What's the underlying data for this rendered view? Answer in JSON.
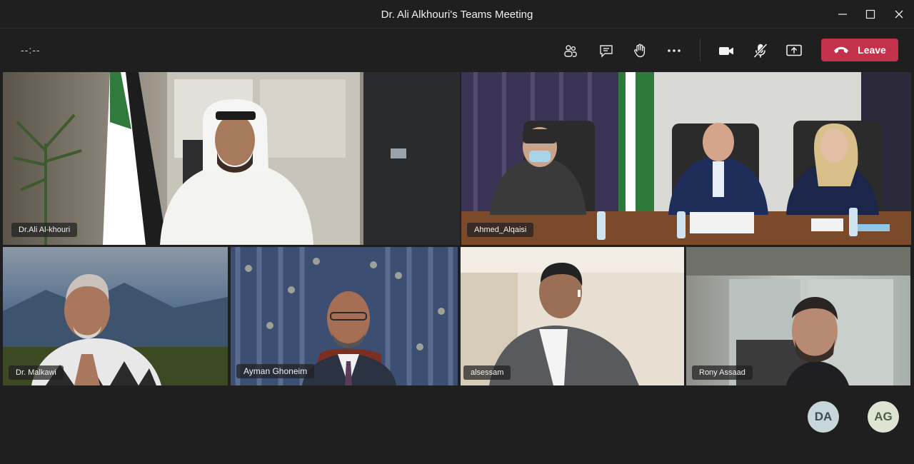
{
  "window": {
    "title": "Dr. Ali Alkhouri's Teams Meeting"
  },
  "toolbar": {
    "timer": "--:--",
    "leave_label": "Leave",
    "leave_color": "#c4314b"
  },
  "participants": [
    {
      "name": "Dr.Ali Al-khouri"
    },
    {
      "name": "Ahmed_Alqaisi"
    },
    {
      "name": "Dr. Malkawi"
    },
    {
      "name": "Ayman Ghoneim"
    },
    {
      "name": "alsessam"
    },
    {
      "name": "Rony Assaad"
    }
  ],
  "avatars": [
    {
      "initials": "DA",
      "bg": "#c7d6d9",
      "fg": "#3c4e56"
    },
    {
      "initials": "AG",
      "bg": "#dde5d2",
      "fg": "#4f5f45"
    }
  ]
}
